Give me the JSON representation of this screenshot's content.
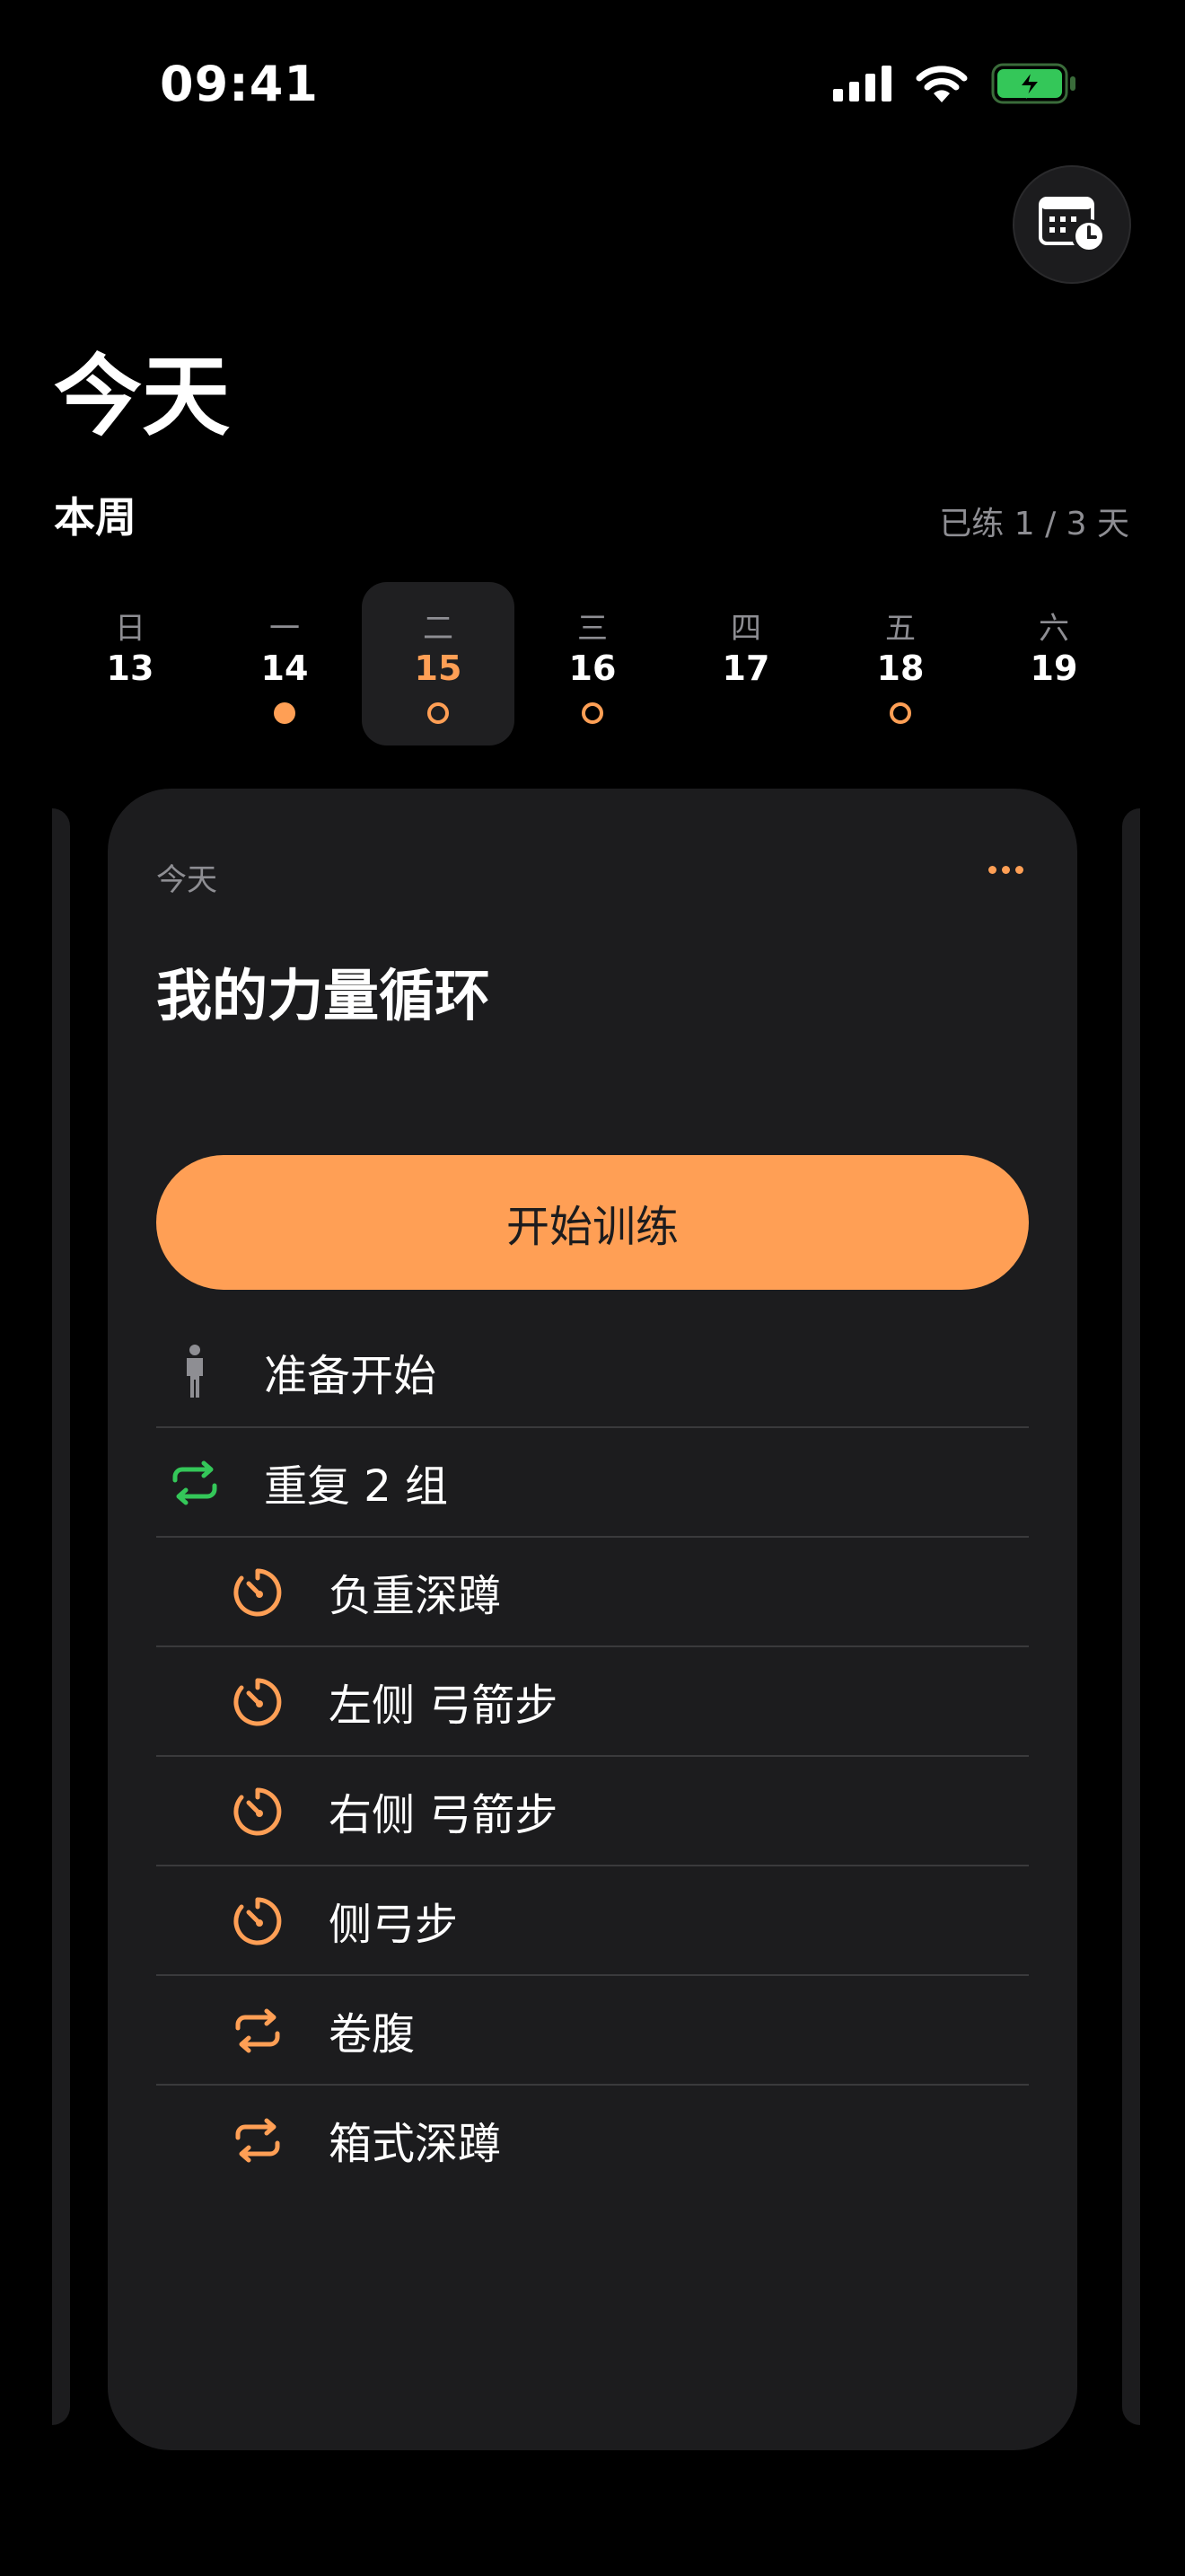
{
  "status_bar": {
    "time": "09:41"
  },
  "icons": {
    "calendar": "calendar-clock-icon",
    "signal": "cellular-signal-icon",
    "wifi": "wifi-icon",
    "battery": "battery-charging-icon"
  },
  "colors": {
    "accent": "#ff9f55",
    "green": "#34c759",
    "card_bg": "#1c1c1e",
    "secondary_text": "#8e8e93"
  },
  "header": {
    "title": "今天"
  },
  "week": {
    "label": "本周",
    "progress": "已练 1 / 3 天",
    "days": [
      {
        "weekday": "日",
        "date": "13",
        "mark": "none",
        "selected": false
      },
      {
        "weekday": "一",
        "date": "14",
        "mark": "filled",
        "selected": false
      },
      {
        "weekday": "二",
        "date": "15",
        "mark": "ring",
        "selected": true
      },
      {
        "weekday": "三",
        "date": "16",
        "mark": "ring",
        "selected": false
      },
      {
        "weekday": "四",
        "date": "17",
        "mark": "none",
        "selected": false
      },
      {
        "weekday": "五",
        "date": "18",
        "mark": "ring",
        "selected": false
      },
      {
        "weekday": "六",
        "date": "19",
        "mark": "none",
        "selected": false
      }
    ]
  },
  "card": {
    "day_label": "今天",
    "title": "我的力量循环",
    "start_label": "开始训练",
    "items": [
      {
        "label": "准备开始",
        "icon": "person-standing-icon",
        "level": "top"
      },
      {
        "label": "重复 2 组",
        "icon": "repeat-icon",
        "level": "top"
      },
      {
        "label": "负重深蹲",
        "icon": "timer-icon",
        "level": "sub"
      },
      {
        "label": "左侧 弓箭步",
        "icon": "timer-icon",
        "level": "sub"
      },
      {
        "label": "右侧 弓箭步",
        "icon": "timer-icon",
        "level": "sub"
      },
      {
        "label": "侧弓步",
        "icon": "timer-icon",
        "level": "sub"
      },
      {
        "label": "卷腹",
        "icon": "repeat-icon",
        "level": "sub"
      },
      {
        "label": "箱式深蹲",
        "icon": "repeat-icon",
        "level": "sub"
      }
    ]
  }
}
